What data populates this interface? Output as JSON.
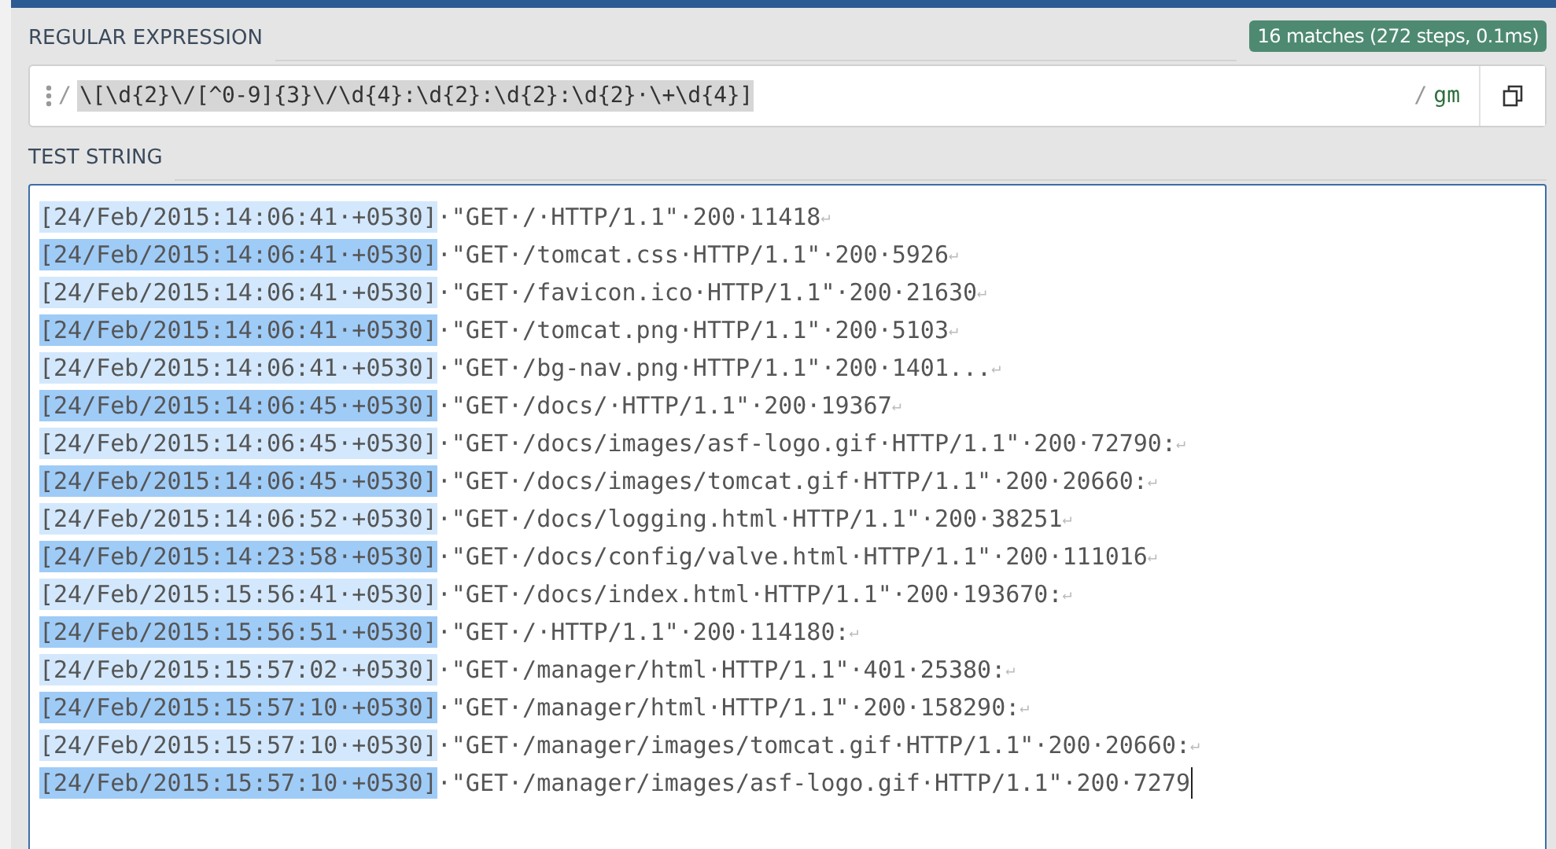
{
  "regex_section": {
    "heading": "REGULAR EXPRESSION",
    "match_info": "16 matches (272 steps, 0.1ms)",
    "delimiter": "/",
    "pattern": "\\[\\d{2}\\/[^0-9]{3}\\/\\d{4}:\\d{2}:\\d{2}:\\d{2}·\\+\\d{4}]",
    "closing_delimiter": "/",
    "flags": "gm"
  },
  "test_section": {
    "heading": "TEST STRING",
    "focused": true,
    "lines": [
      {
        "match": "[24/Feb/2015:14:06:41·+0530]",
        "color": "#d3e8fc",
        "rest": "·\"GET·/·HTTP/1.1\"·200·11418",
        "eol": "↵"
      },
      {
        "match": "[24/Feb/2015:14:06:41·+0530]",
        "color": "#9fcbf7",
        "rest": "·\"GET·/tomcat.css·HTTP/1.1\"·200·5926",
        "eol": "↵"
      },
      {
        "match": "[24/Feb/2015:14:06:41·+0530]",
        "color": "#d3e8fc",
        "rest": "·\"GET·/favicon.ico·HTTP/1.1\"·200·21630",
        "eol": "↵"
      },
      {
        "match": "[24/Feb/2015:14:06:41·+0530]",
        "color": "#9fcbf7",
        "rest": "·\"GET·/tomcat.png·HTTP/1.1\"·200·5103",
        "eol": "↵"
      },
      {
        "match": "[24/Feb/2015:14:06:41·+0530]",
        "color": "#d3e8fc",
        "rest": "·\"GET·/bg-nav.png·HTTP/1.1\"·200·1401...",
        "eol": "↵"
      },
      {
        "match": "[24/Feb/2015:14:06:45·+0530]",
        "color": "#9fcbf7",
        "rest": "·\"GET·/docs/·HTTP/1.1\"·200·19367",
        "eol": "↵"
      },
      {
        "match": "[24/Feb/2015:14:06:45·+0530]",
        "color": "#d3e8fc",
        "rest": "·\"GET·/docs/images/asf-logo.gif·HTTP/1.1\"·200·72790:",
        "eol": "↵"
      },
      {
        "match": "[24/Feb/2015:14:06:45·+0530]",
        "color": "#9fcbf7",
        "rest": "·\"GET·/docs/images/tomcat.gif·HTTP/1.1\"·200·20660:",
        "eol": "↵"
      },
      {
        "match": "[24/Feb/2015:14:06:52·+0530]",
        "color": "#d3e8fc",
        "rest": "·\"GET·/docs/logging.html·HTTP/1.1\"·200·38251",
        "eol": "↵"
      },
      {
        "match": "[24/Feb/2015:14:23:58·+0530]",
        "color": "#9fcbf7",
        "rest": "·\"GET·/docs/config/valve.html·HTTP/1.1\"·200·111016",
        "eol": "↵"
      },
      {
        "match": "[24/Feb/2015:15:56:41·+0530]",
        "color": "#d3e8fc",
        "rest": "·\"GET·/docs/index.html·HTTP/1.1\"·200·193670:",
        "eol": "↵"
      },
      {
        "match": "[24/Feb/2015:15:56:51·+0530]",
        "color": "#9fcbf7",
        "rest": "·\"GET·/·HTTP/1.1\"·200·114180:",
        "eol": "↵"
      },
      {
        "match": "[24/Feb/2015:15:57:02·+0530]",
        "color": "#d3e8fc",
        "rest": "·\"GET·/manager/html·HTTP/1.1\"·401·25380:",
        "eol": "↵"
      },
      {
        "match": "[24/Feb/2015:15:57:10·+0530]",
        "color": "#9fcbf7",
        "rest": "·\"GET·/manager/html·HTTP/1.1\"·200·158290:",
        "eol": "↵"
      },
      {
        "match": "[24/Feb/2015:15:57:10·+0530]",
        "color": "#d3e8fc",
        "rest": "·\"GET·/manager/images/tomcat.gif·HTTP/1.1\"·200·20660:",
        "eol": "↵"
      },
      {
        "match": "[24/Feb/2015:15:57:10·+0530]",
        "color": "#9fcbf7",
        "rest": "·\"GET·/manager/images/asf-logo.gif·HTTP/1.1\"·200·7279",
        "cursor": true
      }
    ]
  }
}
